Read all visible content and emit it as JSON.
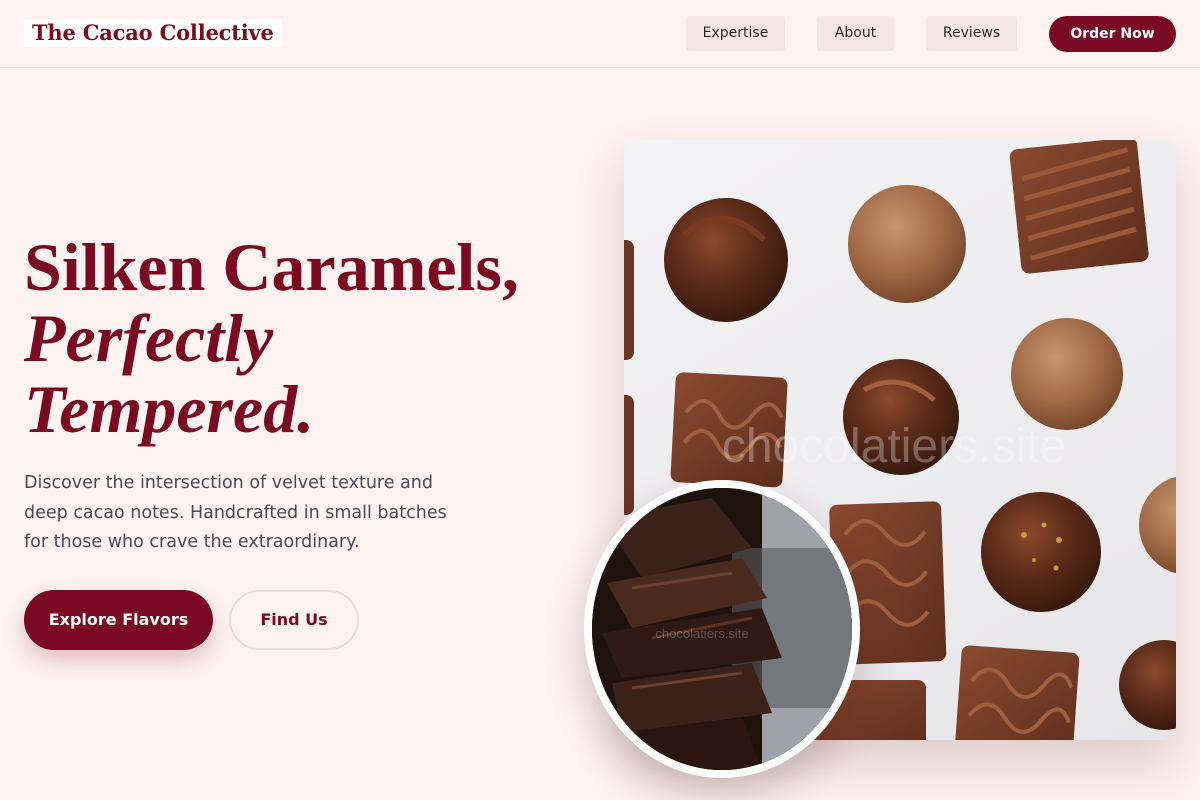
{
  "nav": {
    "brand": "The Cacao Collective",
    "links": [
      {
        "label": "Expertise"
      },
      {
        "label": "About"
      },
      {
        "label": "Reviews"
      }
    ],
    "cta": "Order Now"
  },
  "hero": {
    "headline_line1": "Silken Caramels,",
    "headline_line2": "Perfectly",
    "headline_line3": "Tempered.",
    "description": "Discover the intersection of velvet texture and deep cacao notes. Handcrafted in small batches for those who crave the extraordinary.",
    "primary_cta": "Explore Flavors",
    "secondary_cta": "Find Us"
  },
  "images": {
    "main_watermark": "chocolatiers.site",
    "inset_watermark": "chocolatiers.site"
  },
  "colors": {
    "brand": "#7a0a22",
    "background": "#fdf3f2",
    "nav_button": "#f3e6e4",
    "body_text": "#4a4a55"
  }
}
